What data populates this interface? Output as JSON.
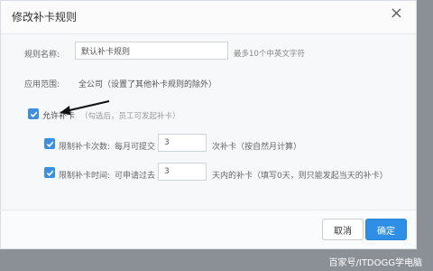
{
  "dialog": {
    "title": "修改补卡规则",
    "close_glyph": "×"
  },
  "form": {
    "rule_name_label": "规则名称:",
    "rule_name_value": "默认补卡规则",
    "rule_name_hint": "最多10个中英文字符",
    "scope_label": "应用范围:",
    "scope_value": "全公司（设置了其他补卡规则的除外）",
    "allow_label": "允许补卡",
    "allow_hint": "（勾选后，员工可发起补卡）",
    "allow_checked": true,
    "limit_count_label": "限制补卡次数:",
    "limit_count_prefix": "每月可提交",
    "limit_count_value": "3",
    "limit_count_suffix": "次补卡（按自然月计算）",
    "limit_count_checked": true,
    "limit_time_label": "限制补卡时间:",
    "limit_time_prefix": "可申请过去",
    "limit_time_value": "3",
    "limit_time_suffix": "天内的补卡（填写0天，则只能发起当天的补卡）",
    "limit_time_checked": true
  },
  "footer": {
    "cancel_label": "取消",
    "ok_label": "确定"
  },
  "colors": {
    "accent": "#2f8ee6",
    "checkbox": "#3d8ee0"
  },
  "watermark": "百家号/ITDOGG学电脑"
}
